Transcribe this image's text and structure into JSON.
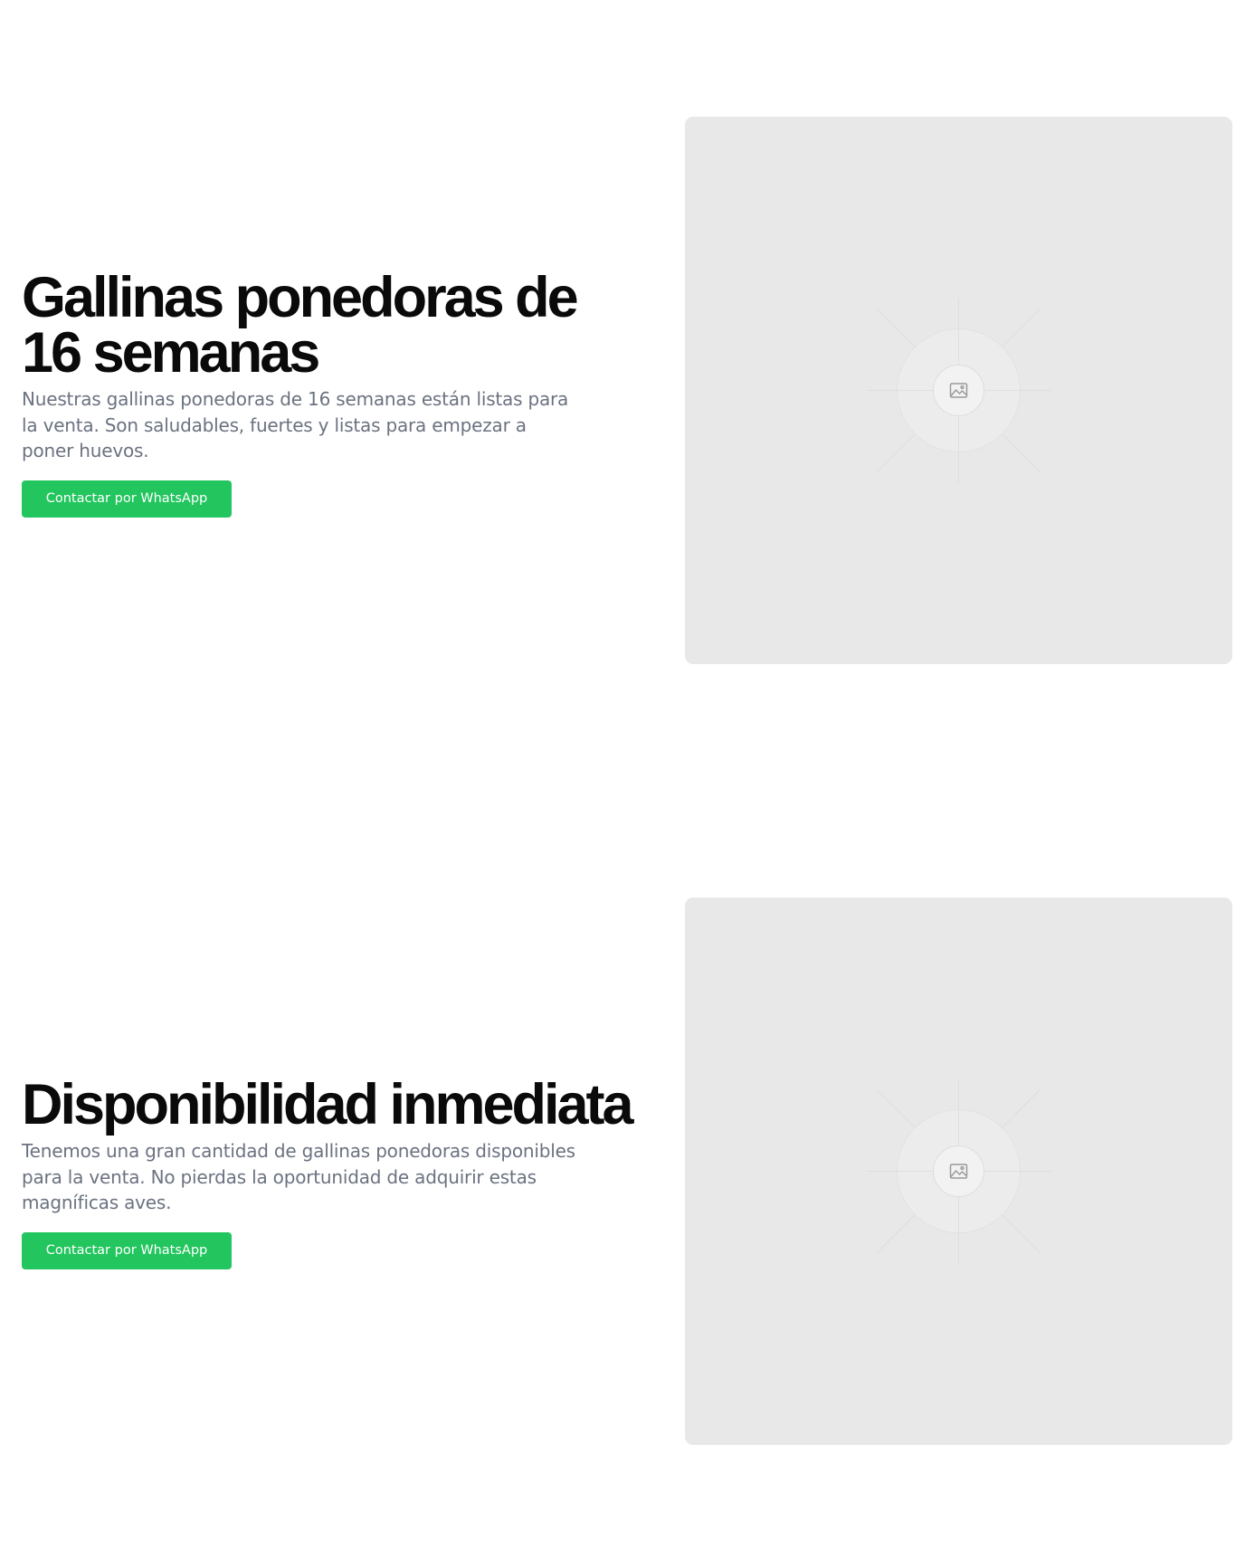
{
  "sections": [
    {
      "heading": "Gallinas ponedoras de 16 semanas",
      "description": "Nuestras gallinas ponedoras de 16 semanas están listas para la venta. Son saludables, fuertes y listas para empezar a poner huevos.",
      "cta_label": "Contactar por WhatsApp",
      "image_icon": "image-icon"
    },
    {
      "heading": "Disponibilidad inmediata",
      "description": "Tenemos una gran cantidad de gallinas ponedoras disponibles para la venta. No pierdas la oportunidad de adquirir estas magníficas aves.",
      "cta_label": "Contactar por WhatsApp",
      "image_icon": "image-icon"
    }
  ],
  "colors": {
    "accent": "#22c55e",
    "heading": "#0a0a0a",
    "body_text": "#6b7280",
    "placeholder_bg": "#e8e8e8"
  }
}
